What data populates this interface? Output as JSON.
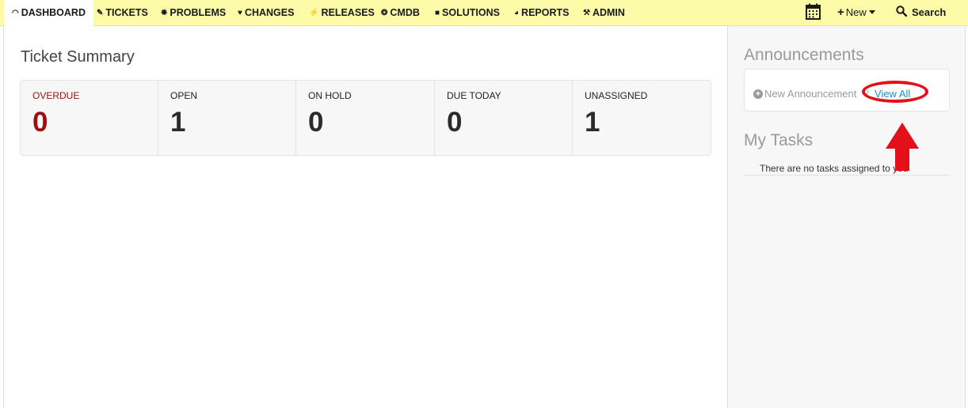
{
  "nav": {
    "items": [
      {
        "label": "DASHBOARD",
        "icon": "gauge-icon",
        "glyph": "◠",
        "active": true
      },
      {
        "label": "TICKETS",
        "icon": "ticket-icon",
        "glyph": "✎"
      },
      {
        "label": "PROBLEMS",
        "icon": "bug-icon",
        "glyph": "✹"
      },
      {
        "label": "CHANGES",
        "icon": "changes-icon",
        "glyph": "♥"
      },
      {
        "label": "RELEASES",
        "icon": "lightning-icon",
        "glyph": "⚡"
      },
      {
        "label": "CMDB",
        "icon": "cube-icon",
        "glyph": "❂"
      },
      {
        "label": "SOLUTIONS",
        "icon": "book-icon",
        "glyph": "■"
      },
      {
        "label": "REPORTS",
        "icon": "pie-chart-icon",
        "glyph": "◕"
      },
      {
        "label": "ADMIN",
        "icon": "tools-icon",
        "glyph": "⚒"
      }
    ],
    "new_label": "New",
    "search_label": "Search"
  },
  "main": {
    "title": "Ticket Summary",
    "summary": [
      {
        "label": "OVERDUE",
        "value": "0"
      },
      {
        "label": "OPEN",
        "value": "1"
      },
      {
        "label": "ON HOLD",
        "value": "0"
      },
      {
        "label": "DUE TODAY",
        "value": "0"
      },
      {
        "label": "UNASSIGNED",
        "value": "1"
      }
    ]
  },
  "sidebar": {
    "announcements_title": "Announcements",
    "new_announcement": "New Announcement",
    "separator": "/",
    "view_all": "View All",
    "tasks_title": "My Tasks",
    "tasks_empty": "There are no tasks assigned to you"
  },
  "colors": {
    "nav_bg": "#fbfba8",
    "overdue": "#9b1111",
    "link": "#1f8fc4",
    "annotation": "#e3101a"
  }
}
